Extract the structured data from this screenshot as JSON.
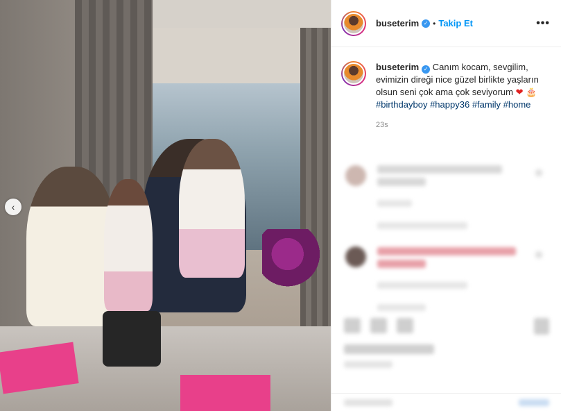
{
  "header": {
    "username": "buseterim",
    "separator": "•",
    "follow_label": "Takip Et",
    "more_label": "•••"
  },
  "caption": {
    "username": "buseterim",
    "text": "Canım kocam, sevgilim, evimizin direği nice güzel birlikte yaşların olsun seni çok ama çok seviyorum",
    "emoji_heart": "❤",
    "emoji_cake": "🎂",
    "hashtags": [
      "#birthdayboy",
      "#happy36",
      "#family",
      "#home"
    ],
    "time": "23s"
  },
  "media": {
    "carousel_prev_label": "‹"
  },
  "colors": {
    "accent": "#0095f6",
    "verified": "#3897f0",
    "hashtag": "#00376b"
  }
}
